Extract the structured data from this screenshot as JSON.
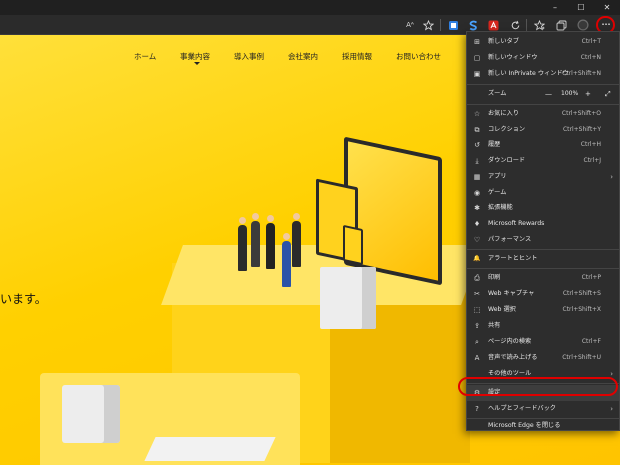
{
  "toolbar": {
    "icons": [
      "read-aloud-icon",
      "add-favorite-icon",
      "extension-blue-icon",
      "extension-s-icon",
      "acrobat-icon",
      "refresh-icon",
      "favorites-icon",
      "collections-icon",
      "profile-icon",
      "more-icon"
    ],
    "read_aloud_glyph": "Aᴬ",
    "more_glyph": "···"
  },
  "window_controls": {
    "minimize": "–",
    "maximize": "☐",
    "close": "✕"
  },
  "site": {
    "nav": [
      "ホーム",
      "事業内容",
      "導入事例",
      "会社案内",
      "採用情報",
      "お問い合わせ"
    ],
    "tagline": "います。",
    "colors": {
      "background": "#ffce00",
      "accent": "#e00000"
    }
  },
  "menu": {
    "items": [
      {
        "icon": "new-tab-icon",
        "glyph": "⊞",
        "label": "新しいタブ",
        "shortcut": "Ctrl+T"
      },
      {
        "icon": "new-window-icon",
        "glyph": "▢",
        "label": "新しいウィンドウ",
        "shortcut": "Ctrl+N"
      },
      {
        "icon": "inprivate-window-icon",
        "glyph": "▣",
        "label": "新しい InPrivate ウィンドウ",
        "shortcut": "Ctrl+Shift+N"
      },
      {
        "icon": "favorites-icon",
        "glyph": "☆",
        "label": "お気に入り",
        "shortcut": "Ctrl+Shift+O"
      },
      {
        "icon": "collections-icon",
        "glyph": "⧉",
        "label": "コレクション",
        "shortcut": "Ctrl+Shift+Y"
      },
      {
        "icon": "history-icon",
        "glyph": "↺",
        "label": "履歴",
        "shortcut": "Ctrl+H"
      },
      {
        "icon": "download-icon",
        "glyph": "⤓",
        "label": "ダウンロード",
        "shortcut": "Ctrl+J"
      },
      {
        "icon": "apps-icon",
        "glyph": "▦",
        "label": "アプリ",
        "shortcut": "",
        "submenu": true
      },
      {
        "icon": "games-icon",
        "glyph": "◉",
        "label": "ゲーム",
        "shortcut": ""
      },
      {
        "icon": "extensions-icon",
        "glyph": "✱",
        "label": "拡張機能",
        "shortcut": ""
      },
      {
        "icon": "rewards-icon",
        "glyph": "♦",
        "label": "Microsoft Rewards",
        "shortcut": ""
      },
      {
        "icon": "performance-icon",
        "glyph": "♡",
        "label": "パフォーマンス",
        "shortcut": ""
      },
      {
        "icon": "alerts-icon",
        "glyph": "🔔",
        "label": "アラートとヒント",
        "shortcut": ""
      },
      {
        "icon": "print-icon",
        "glyph": "⎙",
        "label": "印刷",
        "shortcut": "Ctrl+P"
      },
      {
        "icon": "web-capture-icon",
        "glyph": "✂",
        "label": "Web キャプチャ",
        "shortcut": "Ctrl+Shift+S"
      },
      {
        "icon": "web-select-icon",
        "glyph": "⬚",
        "label": "Web 選択",
        "shortcut": "Ctrl+Shift+X"
      },
      {
        "icon": "share-icon",
        "glyph": "⇪",
        "label": "共有",
        "shortcut": ""
      },
      {
        "icon": "find-on-page-icon",
        "glyph": "⌕",
        "label": "ページ内の検索",
        "shortcut": "Ctrl+F"
      },
      {
        "icon": "read-aloud-icon",
        "glyph": "A",
        "label": "音声で読み上げる",
        "shortcut": "Ctrl+Shift+U"
      },
      {
        "icon": "",
        "glyph": "",
        "label": "その他のツール",
        "shortcut": "",
        "submenu": true
      },
      {
        "icon": "settings-icon",
        "glyph": "⚙",
        "label": "設定",
        "shortcut": ""
      },
      {
        "icon": "help-icon",
        "glyph": "?",
        "label": "ヘルプとフィードバック",
        "shortcut": "",
        "submenu": true
      },
      {
        "icon": "",
        "glyph": "",
        "label": "Microsoft Edge を閉じる",
        "shortcut": ""
      }
    ],
    "zoom": {
      "label": "ズーム",
      "minus": "—",
      "value": "100%",
      "plus": "+",
      "fullscreen": "⤢"
    },
    "submenu_arrow": "›"
  }
}
